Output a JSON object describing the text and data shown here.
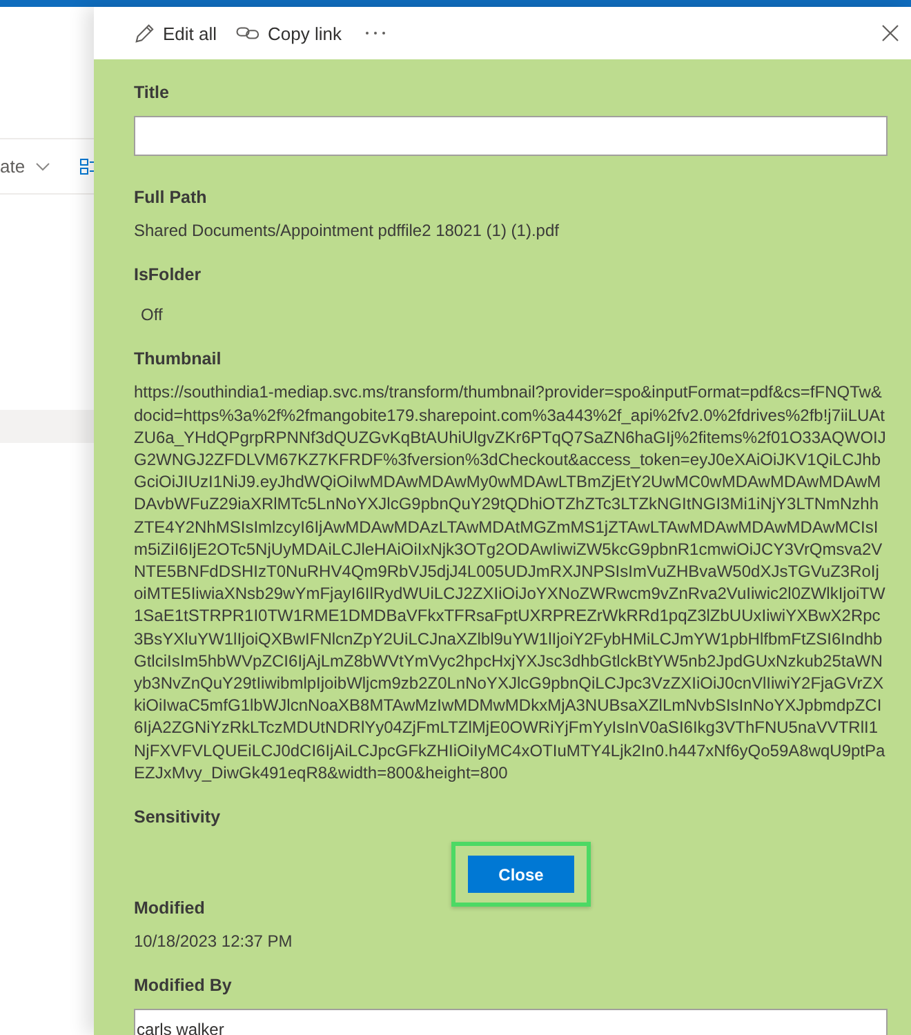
{
  "background_page": {
    "toolbar_label": "ate",
    "selected_row": true
  },
  "panel": {
    "toolbar": [
      {
        "kind": "edit",
        "label": "Edit all"
      },
      {
        "kind": "link",
        "label": "Copy link"
      }
    ],
    "fields": [
      {
        "kind": "input",
        "label": "Title"
      },
      {
        "kind": "text",
        "label": "Full Path",
        "value": "Shared Documents/Appointment pdffile2 18021 (1) (1).pdf"
      },
      {
        "kind": "toggle",
        "label": "IsFolder",
        "value": "Off"
      },
      {
        "kind": "text",
        "label": "Thumbnail",
        "value": "https://southindia1-mediap.svc.ms/transform/thumbnail?provider=spo&inputFormat=pdf&cs=fFNQTw&docid=https%3a%2f%2fmangobite179.sharepoint.com%3a443%2f_api%2fv2.0%2fdrives%2fb!j7iiLUAtZU6a_YHdQPgrpRPNNf3dQUZGvKqBtAUhiUlgvZKr6PTqQ7SaZN6haGIj%2fitems%2f01O33AQWOIJG2WNGJ2ZFDLVM67KZ7KFRDF%3fversion%3dCheckout&access_token=eyJ0eXAiOiJKV1QiLCJhbGciOiJIUzI1NiJ9.eyJhdWQiOiIwMDAwMDAwMy0wMDAwLTBmZjEtY2UwMC0wMDAwMDAwMDAwMDAvbWFuZ29iaXRlMTc5LnNoYXJlcG9pbnQuY29tQDhiOTZhZTc3LTZkNGItNGI3Mi1iNjY3LTNmNzhhZTE4Y2NhMSIsImlzcyI6IjAwMDAwMDAzLTAwMDAtMGZmMS1jZTAwLTAwMDAwMDAwMDAwMCIsIm5iZiI6IjE2OTc5NjUyMDAiLCJleHAiOiIxNjk3OTg2ODAwIiwiZW5kcG9pbnR1cmwiOiJCY3VrQmsva2VNTE5BNFdDSHIzT0NuRHV4Qm9RbVJ5djJ4L005UDJmRXJNPSIsImVuZHBvaW50dXJsTGVuZ3RoIjoiMTE5IiwiaXNsb29wYmFjayI6IlRydWUiLCJ2ZXIiOiJoYXNoZWRwcm9vZnRva2VuIiwic2l0ZWlkIjoiTW1SaE1tSTRPR1I0TW1RME1DMDBaVFkxTFRsaFptUXRPREZrWkRRd1pqZ3lZbUUxIiwiYXBwX2Rpc3BsYXluYW1lIjoiQXBwIFNlcnZpY2UiLCJnaXZlbl9uYW1lIjoiY2FybHMiLCJmYW1pbHlfbmFtZSI6IndhbGtlciIsIm5hbWVpZCI6IjAjLmZ8bWVtYmVyc2hpcHxjYXJsc3dhbGtlckBtYW5nb2JpdGUxNzkub25taWNyb3NvZnQuY29tIiwibmlpIjoibWljcm9zb2Z0LnNoYXJlcG9pbnQiLCJpc3VzZXIiOiJ0cnVlIiwiY2FjaGVrZXkiOiIwaC5mfG1lbWJlcnNoaXB8MTAwMzIwMDMwMDkxMjA3NUBsaXZlLmNvbSIsInNoYXJpbmdpZCI6IjA2ZGNiYzRkLTczMDUtNDRlYy04ZjFmLTZlMjE0OWRiYjFmYyIsInV0aSI6Ikg3VThFNU5naVVTRlI1NjFXVFVLQUEiLCJ0dCI6IjAiLCJpcGFkZHIiOiIyMC4xOTIuMTY4Ljk2In0.h447xNf6yQo59A8wqU9ptPaEZJxMvy_DiwGk491eqR8&width=800&height=800"
      },
      {
        "kind": "empty",
        "label": "Sensitivity"
      },
      {
        "kind": "text",
        "label": "Modified",
        "value": "10/18/2023 12:37 PM"
      },
      {
        "kind": "input",
        "label": "Modified By",
        "value": "carls walker"
      }
    ],
    "close_button": {
      "label": "Close",
      "highlighted": true
    }
  }
}
